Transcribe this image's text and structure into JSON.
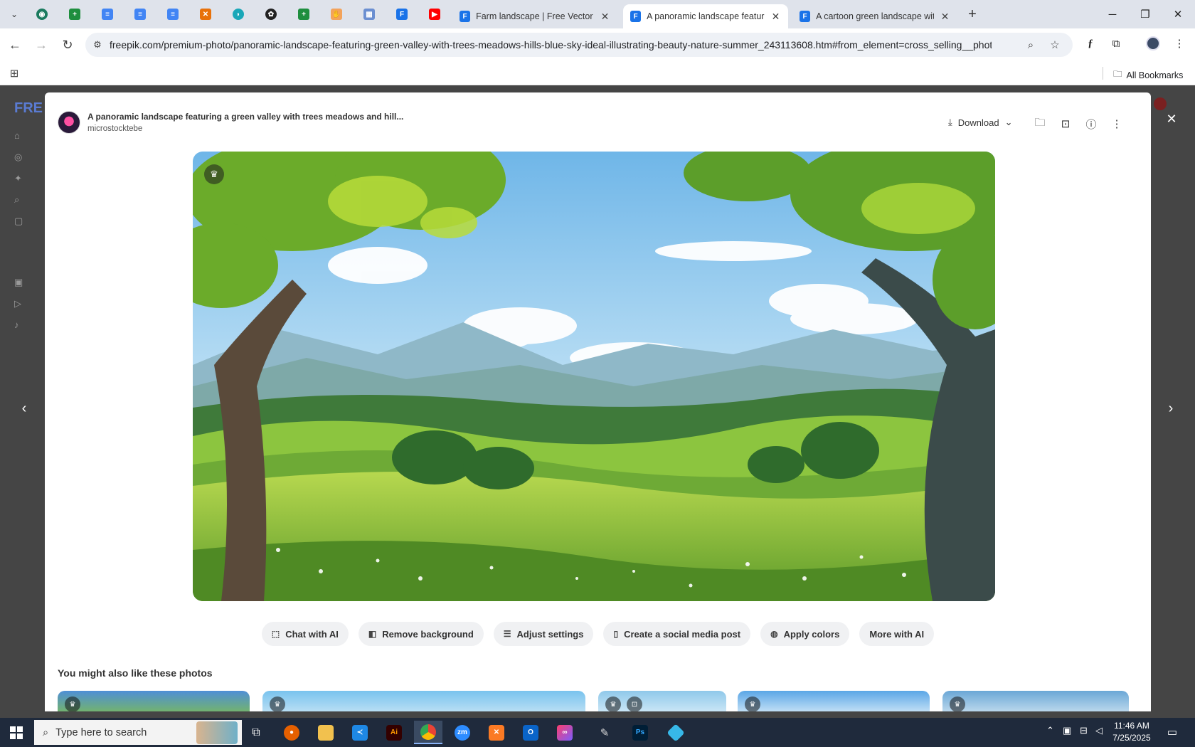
{
  "browser": {
    "tabs": [
      {
        "title": "Farm landscape | Free Vector",
        "active": false
      },
      {
        "title": "A panoramic landscape featuring",
        "active": true
      },
      {
        "title": "A cartoon green landscape with",
        "active": false
      }
    ],
    "url": "freepik.com/premium-photo/panoramic-landscape-featuring-green-valley-with-trees-meadows-hills-blue-sky-ideal-illustrating-beauty-nature-summer_243113608.htm#from_element=cross_selling__photo",
    "bookmarks_label": "All Bookmarks"
  },
  "modal": {
    "title": "A panoramic landscape featuring a green valley with trees meadows and hill...",
    "author": "microstocktebe",
    "download_label": "Download",
    "ai_actions": [
      {
        "label": "Chat with AI",
        "icon": "chat-icon"
      },
      {
        "label": "Remove background",
        "icon": "eraser-icon"
      },
      {
        "label": "Adjust settings",
        "icon": "sliders-icon"
      },
      {
        "label": "Create a social media post",
        "icon": "phone-icon"
      },
      {
        "label": "Apply colors",
        "icon": "palette-icon"
      },
      {
        "label": "More with AI",
        "icon": ""
      }
    ],
    "related_heading": "You might also like these photos"
  },
  "taskbar": {
    "search_placeholder": "Type here to search",
    "time": "11:46 AM",
    "date": "7/25/2025"
  },
  "colors": {
    "tab_bar": "#dfe3eb",
    "taskbar": "#1f2a3c",
    "ai_button": "#f0f1f3"
  }
}
